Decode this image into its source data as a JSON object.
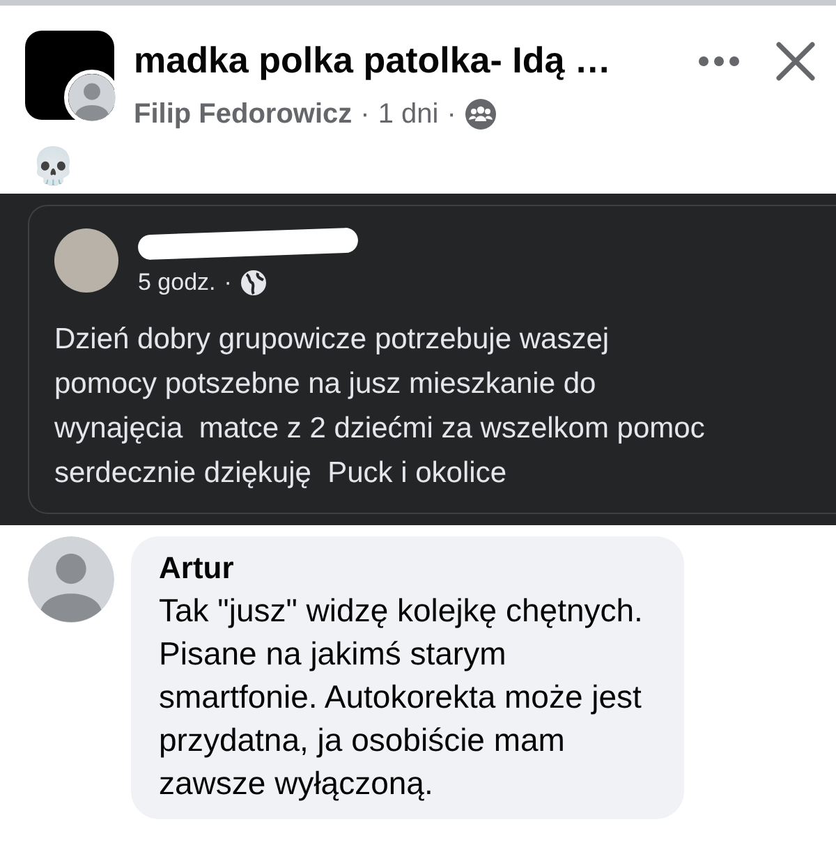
{
  "header": {
    "group_name": "madka polka patolka- Idą …",
    "author": "Filip Fedorowicz",
    "time": "1 dni",
    "separator": "·"
  },
  "post_text": "💀",
  "shared_post": {
    "time": "5 godz.",
    "separator": "·",
    "author_redacted": true,
    "text_lines": [
      "Dzień dobry grupowicze potrzebuje waszej",
      "pomocy potszebne na jusz mieszkanie do",
      "wynajęcia  matce z 2 dziećmi za wszelkom pomoc",
      "serdecznie dziękuję  Puck i okolice"
    ]
  },
  "comment": {
    "author": "Artur",
    "text_lines": [
      "Tak \"jusz\" widzę kolejkę chętnych.",
      "Pisane na jakimś starym",
      "smartfonie. Autokorekta może jest",
      "przydatna, ja osobiście mam",
      "zawsze wyłączoną."
    ]
  }
}
